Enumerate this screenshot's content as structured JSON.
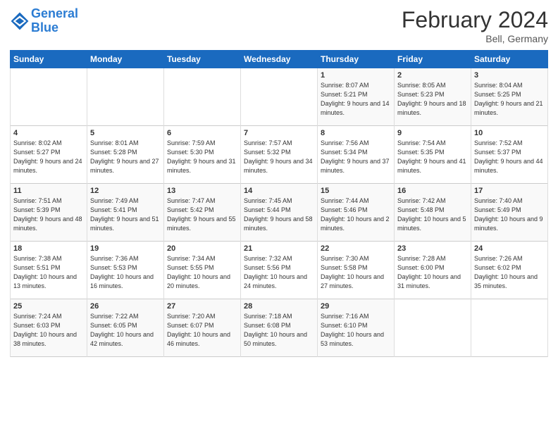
{
  "logo": {
    "line1": "General",
    "line2": "Blue"
  },
  "title": "February 2024",
  "subtitle": "Bell, Germany",
  "weekdays": [
    "Sunday",
    "Monday",
    "Tuesday",
    "Wednesday",
    "Thursday",
    "Friday",
    "Saturday"
  ],
  "weeks": [
    [
      {
        "day": "",
        "sunrise": "",
        "sunset": "",
        "daylight": ""
      },
      {
        "day": "",
        "sunrise": "",
        "sunset": "",
        "daylight": ""
      },
      {
        "day": "",
        "sunrise": "",
        "sunset": "",
        "daylight": ""
      },
      {
        "day": "",
        "sunrise": "",
        "sunset": "",
        "daylight": ""
      },
      {
        "day": "1",
        "sunrise": "Sunrise: 8:07 AM",
        "sunset": "Sunset: 5:21 PM",
        "daylight": "Daylight: 9 hours and 14 minutes."
      },
      {
        "day": "2",
        "sunrise": "Sunrise: 8:05 AM",
        "sunset": "Sunset: 5:23 PM",
        "daylight": "Daylight: 9 hours and 18 minutes."
      },
      {
        "day": "3",
        "sunrise": "Sunrise: 8:04 AM",
        "sunset": "Sunset: 5:25 PM",
        "daylight": "Daylight: 9 hours and 21 minutes."
      }
    ],
    [
      {
        "day": "4",
        "sunrise": "Sunrise: 8:02 AM",
        "sunset": "Sunset: 5:27 PM",
        "daylight": "Daylight: 9 hours and 24 minutes."
      },
      {
        "day": "5",
        "sunrise": "Sunrise: 8:01 AM",
        "sunset": "Sunset: 5:28 PM",
        "daylight": "Daylight: 9 hours and 27 minutes."
      },
      {
        "day": "6",
        "sunrise": "Sunrise: 7:59 AM",
        "sunset": "Sunset: 5:30 PM",
        "daylight": "Daylight: 9 hours and 31 minutes."
      },
      {
        "day": "7",
        "sunrise": "Sunrise: 7:57 AM",
        "sunset": "Sunset: 5:32 PM",
        "daylight": "Daylight: 9 hours and 34 minutes."
      },
      {
        "day": "8",
        "sunrise": "Sunrise: 7:56 AM",
        "sunset": "Sunset: 5:34 PM",
        "daylight": "Daylight: 9 hours and 37 minutes."
      },
      {
        "day": "9",
        "sunrise": "Sunrise: 7:54 AM",
        "sunset": "Sunset: 5:35 PM",
        "daylight": "Daylight: 9 hours and 41 minutes."
      },
      {
        "day": "10",
        "sunrise": "Sunrise: 7:52 AM",
        "sunset": "Sunset: 5:37 PM",
        "daylight": "Daylight: 9 hours and 44 minutes."
      }
    ],
    [
      {
        "day": "11",
        "sunrise": "Sunrise: 7:51 AM",
        "sunset": "Sunset: 5:39 PM",
        "daylight": "Daylight: 9 hours and 48 minutes."
      },
      {
        "day": "12",
        "sunrise": "Sunrise: 7:49 AM",
        "sunset": "Sunset: 5:41 PM",
        "daylight": "Daylight: 9 hours and 51 minutes."
      },
      {
        "day": "13",
        "sunrise": "Sunrise: 7:47 AM",
        "sunset": "Sunset: 5:42 PM",
        "daylight": "Daylight: 9 hours and 55 minutes."
      },
      {
        "day": "14",
        "sunrise": "Sunrise: 7:45 AM",
        "sunset": "Sunset: 5:44 PM",
        "daylight": "Daylight: 9 hours and 58 minutes."
      },
      {
        "day": "15",
        "sunrise": "Sunrise: 7:44 AM",
        "sunset": "Sunset: 5:46 PM",
        "daylight": "Daylight: 10 hours and 2 minutes."
      },
      {
        "day": "16",
        "sunrise": "Sunrise: 7:42 AM",
        "sunset": "Sunset: 5:48 PM",
        "daylight": "Daylight: 10 hours and 5 minutes."
      },
      {
        "day": "17",
        "sunrise": "Sunrise: 7:40 AM",
        "sunset": "Sunset: 5:49 PM",
        "daylight": "Daylight: 10 hours and 9 minutes."
      }
    ],
    [
      {
        "day": "18",
        "sunrise": "Sunrise: 7:38 AM",
        "sunset": "Sunset: 5:51 PM",
        "daylight": "Daylight: 10 hours and 13 minutes."
      },
      {
        "day": "19",
        "sunrise": "Sunrise: 7:36 AM",
        "sunset": "Sunset: 5:53 PM",
        "daylight": "Daylight: 10 hours and 16 minutes."
      },
      {
        "day": "20",
        "sunrise": "Sunrise: 7:34 AM",
        "sunset": "Sunset: 5:55 PM",
        "daylight": "Daylight: 10 hours and 20 minutes."
      },
      {
        "day": "21",
        "sunrise": "Sunrise: 7:32 AM",
        "sunset": "Sunset: 5:56 PM",
        "daylight": "Daylight: 10 hours and 24 minutes."
      },
      {
        "day": "22",
        "sunrise": "Sunrise: 7:30 AM",
        "sunset": "Sunset: 5:58 PM",
        "daylight": "Daylight: 10 hours and 27 minutes."
      },
      {
        "day": "23",
        "sunrise": "Sunrise: 7:28 AM",
        "sunset": "Sunset: 6:00 PM",
        "daylight": "Daylight: 10 hours and 31 minutes."
      },
      {
        "day": "24",
        "sunrise": "Sunrise: 7:26 AM",
        "sunset": "Sunset: 6:02 PM",
        "daylight": "Daylight: 10 hours and 35 minutes."
      }
    ],
    [
      {
        "day": "25",
        "sunrise": "Sunrise: 7:24 AM",
        "sunset": "Sunset: 6:03 PM",
        "daylight": "Daylight: 10 hours and 38 minutes."
      },
      {
        "day": "26",
        "sunrise": "Sunrise: 7:22 AM",
        "sunset": "Sunset: 6:05 PM",
        "daylight": "Daylight: 10 hours and 42 minutes."
      },
      {
        "day": "27",
        "sunrise": "Sunrise: 7:20 AM",
        "sunset": "Sunset: 6:07 PM",
        "daylight": "Daylight: 10 hours and 46 minutes."
      },
      {
        "day": "28",
        "sunrise": "Sunrise: 7:18 AM",
        "sunset": "Sunset: 6:08 PM",
        "daylight": "Daylight: 10 hours and 50 minutes."
      },
      {
        "day": "29",
        "sunrise": "Sunrise: 7:16 AM",
        "sunset": "Sunset: 6:10 PM",
        "daylight": "Daylight: 10 hours and 53 minutes."
      },
      {
        "day": "",
        "sunrise": "",
        "sunset": "",
        "daylight": ""
      },
      {
        "day": "",
        "sunrise": "",
        "sunset": "",
        "daylight": ""
      }
    ]
  ]
}
